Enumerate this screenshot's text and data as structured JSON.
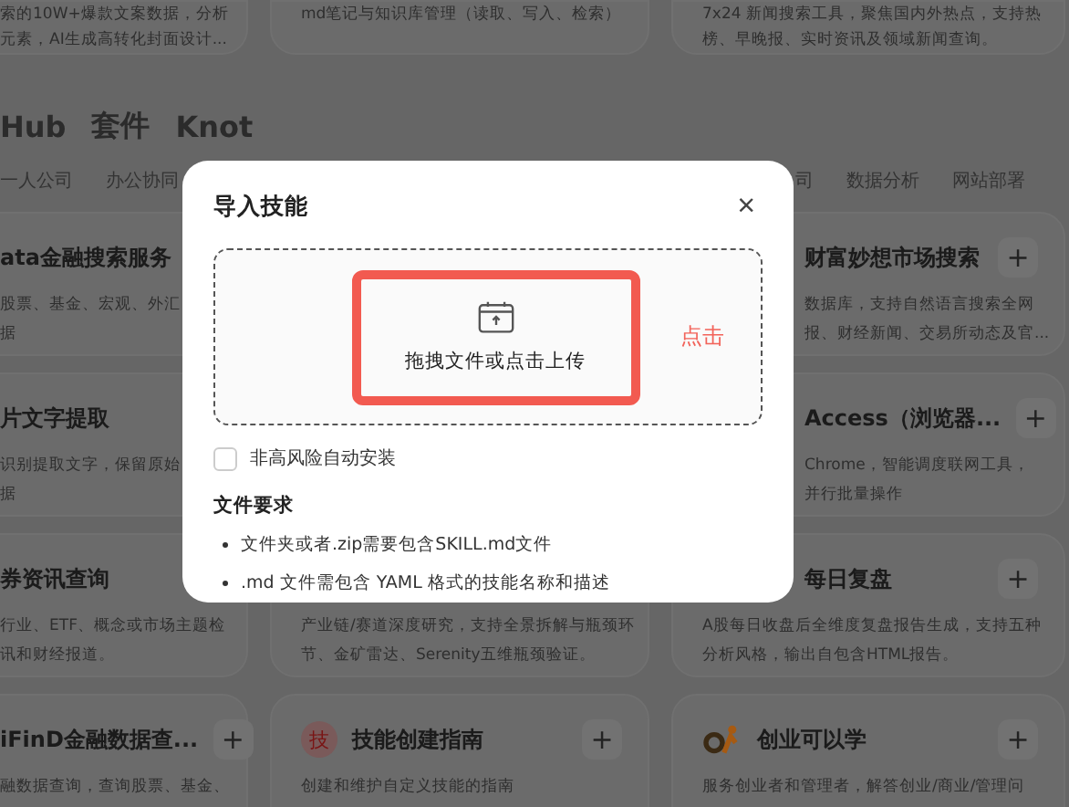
{
  "top_cards": [
    {
      "lines": [
        "索的10W+爆款文案数据，分析",
        "元素，AI生成高转化封面设计..."
      ]
    },
    {
      "lines": [
        "md笔记与知识库管理（读取、写入、检索）"
      ]
    },
    {
      "lines": [
        "7x24 新闻搜索工具，聚焦国内外热点，支持热",
        "榜、早晚报、实时资讯及领域新闻查询。"
      ]
    }
  ],
  "section_tabs": [
    "Hub",
    "套件",
    "Knot"
  ],
  "categories_left": [
    "一人公司",
    "办公协同"
  ],
  "categories_right": [
    "司",
    "数据分析",
    "网站部署"
  ],
  "columns": [
    {
      "cards": [
        {
          "title": "ata金融搜索服务",
          "desc": [
            "股票、基金、宏观、外汇",
            "据"
          ]
        },
        {
          "title": "片文字提取",
          "desc": [
            "识别提取文字，保留原始",
            "据"
          ]
        },
        {
          "title": "券资讯查询",
          "desc": [
            "行业、ETF、概念或市场主题检",
            "讯和财经报道。"
          ]
        },
        {
          "title": "iFinD金融数据查...",
          "add": "+",
          "desc": [
            "融数据查询，查询股票、基金、"
          ]
        }
      ]
    },
    {
      "cards": [
        {
          "desc": [
            "产业链/赛道深度研究，支持全景拆解与瓶颈环",
            "节、金矿雷达、Serenity五维瓶颈验证。"
          ]
        },
        {
          "icon": {
            "kind": "char",
            "text": "技"
          },
          "title": "技能创建指南",
          "add": "+",
          "desc": [
            "创建和维护自定义技能的指南"
          ]
        }
      ]
    },
    {
      "cards": [
        {
          "title": "财富妙想市场搜索",
          "add": "+",
          "desc": [
            "数据库，支持自然语言搜索全网",
            "报、财经新闻、交易所动态及官..."
          ]
        },
        {
          "title": "Access（浏览器...",
          "add": "+",
          "desc": [
            "Chrome，智能调度联网工具，",
            "并行批量操作"
          ]
        },
        {
          "title": "每日复盘",
          "add": "+",
          "desc": [
            "A股每日收盘后全维度复盘报告生成，支持五种",
            "分析风格，输出自包含HTML报告。"
          ]
        },
        {
          "icon": {
            "kind": "logo"
          },
          "title": "创业可以学",
          "add": "+",
          "desc": [
            "服务创业者和管理者，解答创业/商业/管理问"
          ]
        }
      ]
    }
  ],
  "dialog": {
    "title": "导入技能",
    "close": "×",
    "upload": {
      "label": "拖拽文件或点击上传",
      "annotation": "点击"
    },
    "auto_install": {
      "label": "非高风险自动安装",
      "checked": false
    },
    "requirements_title": "文件要求",
    "requirements": [
      "文件夹或者.zip需要包含SKILL.md文件",
      ".md 文件需包含 YAML 格式的技能名称和描述"
    ]
  }
}
